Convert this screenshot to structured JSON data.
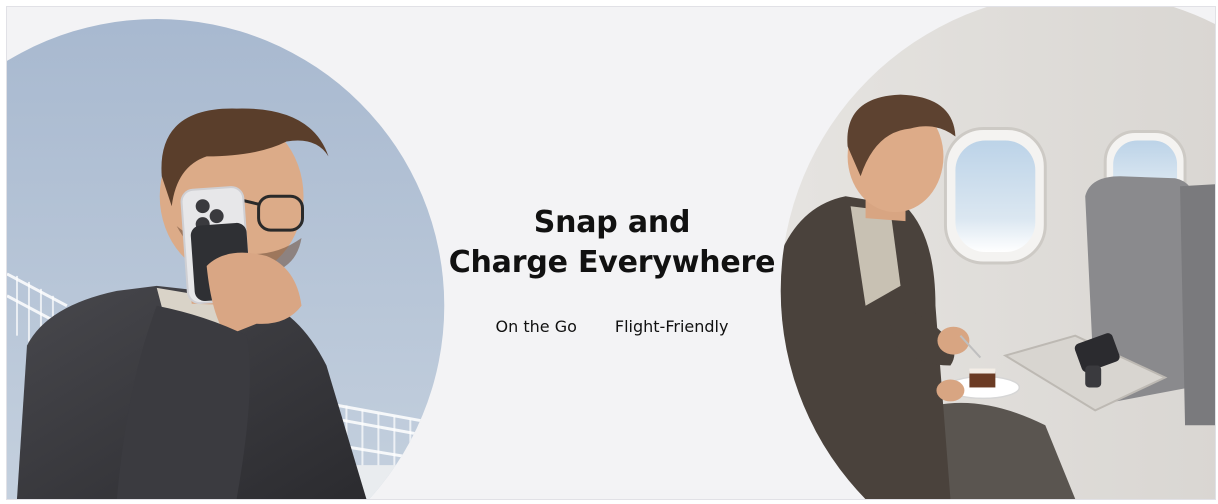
{
  "banner": {
    "headline_line1": "Snap and",
    "headline_line2": "Charge Everywhere",
    "features": [
      {
        "label": "On the Go"
      },
      {
        "label": "Flight-Friendly"
      }
    ]
  },
  "colors": {
    "background": "#f3f3f5",
    "sky": "#aebfd4",
    "jacket": "#3a3a3e",
    "text": "#111111"
  }
}
